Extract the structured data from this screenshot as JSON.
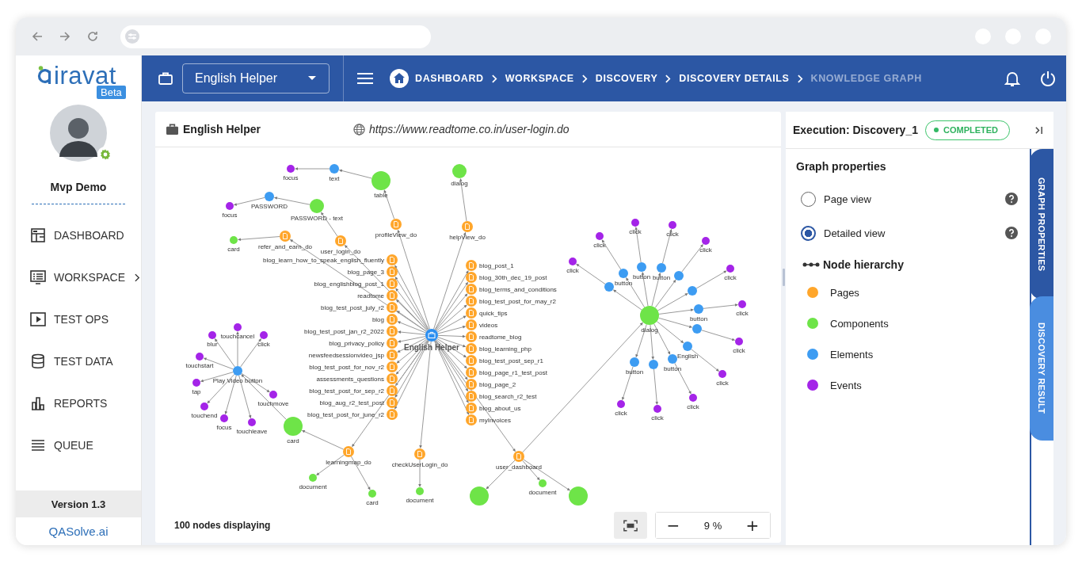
{
  "sidebar": {
    "logo": "iravat",
    "badge": "Beta",
    "user": "Mvp Demo",
    "menu": [
      {
        "label": "DASHBOARD",
        "has_submenu": false
      },
      {
        "label": "WORKSPACE",
        "has_submenu": true
      },
      {
        "label": "TEST OPS",
        "has_submenu": false
      },
      {
        "label": "TEST DATA",
        "has_submenu": false
      },
      {
        "label": "REPORTS",
        "has_submenu": false
      },
      {
        "label": "QUEUE",
        "has_submenu": false
      }
    ],
    "version": "Version 1.3",
    "brand": "QASolve.ai"
  },
  "header": {
    "project": "English Helper",
    "breadcrumbs": [
      {
        "label": "DASHBOARD",
        "current": false
      },
      {
        "label": "WORKSPACE",
        "current": false
      },
      {
        "label": "DISCOVERY",
        "current": false
      },
      {
        "label": "DISCOVERY DETAILS",
        "current": false
      },
      {
        "label": "KNOWLEDGE GRAPH",
        "current": true
      }
    ]
  },
  "graph_card": {
    "title": "English Helper",
    "url": "https://www.readtome.co.in/user-login.do",
    "graph": {
      "label": "English Helper",
      "kind": "root",
      "children": [
        {
          "label": "profileView_do",
          "kind": "page",
          "children": [
            {
              "label": "table",
              "kind": "component",
              "children": [
                {
                  "label": "text",
                  "kind": "element",
                  "children": [
                    {
                      "label": "focus",
                      "kind": "event"
                    }
                  ]
                }
              ]
            }
          ]
        },
        {
          "label": "helpView_do",
          "kind": "page",
          "children": [
            {
              "label": "dialog",
              "kind": "component"
            }
          ]
        },
        {
          "label": "refer_and_earn_do",
          "kind": "page",
          "children": [
            {
              "label": "card",
              "kind": "component"
            }
          ]
        },
        {
          "label": "user_login_do",
          "kind": "page",
          "children": [
            {
              "label": "PASSWORD - text",
              "kind": "component",
              "children": [
                {
                  "label": "PASSWORD",
                  "kind": "element",
                  "children": [
                    {
                      "label": "focus",
                      "kind": "event"
                    }
                  ]
                }
              ]
            }
          ]
        },
        {
          "label": "blog_learn_how_to_speak_english_fluently",
          "kind": "page"
        },
        {
          "label": "blog_post_1",
          "kind": "page"
        },
        {
          "label": "blog_page_3",
          "kind": "page"
        },
        {
          "label": "blog_30th_dec_19_post",
          "kind": "page"
        },
        {
          "label": "blog_englishblog_post_1",
          "kind": "page"
        },
        {
          "label": "blog_terms_and_conditions",
          "kind": "page"
        },
        {
          "label": "readtome",
          "kind": "page"
        },
        {
          "label": "blog_test_post_for_may_r2",
          "kind": "page"
        },
        {
          "label": "blog_test_post_july_r2",
          "kind": "page"
        },
        {
          "label": "quick_tips",
          "kind": "page"
        },
        {
          "label": "blog",
          "kind": "page"
        },
        {
          "label": "videos",
          "kind": "page"
        },
        {
          "label": "blog_test_post_jan_r2_2022",
          "kind": "page"
        },
        {
          "label": "readtome_blog",
          "kind": "page"
        },
        {
          "label": "blog_privacy_policy",
          "kind": "page"
        },
        {
          "label": "blog_learning_php",
          "kind": "page"
        },
        {
          "label": "newsfeedsessionvideo_jsp",
          "kind": "page"
        },
        {
          "label": "blog_test_post_sep_r1",
          "kind": "page"
        },
        {
          "label": "blog_test_post_for_nov_r2",
          "kind": "page"
        },
        {
          "label": "blog_page_r1_test_post",
          "kind": "page"
        },
        {
          "label": "assessments_questions",
          "kind": "page"
        },
        {
          "label": "blog_page_2",
          "kind": "page"
        },
        {
          "label": "blog_test_post_for_sep_r2",
          "kind": "page"
        },
        {
          "label": "blog_search_r2_test",
          "kind": "page"
        },
        {
          "label": "blog_aug_r2_test_post",
          "kind": "page"
        },
        {
          "label": "blog_about_us",
          "kind": "page"
        },
        {
          "label": "blog_test_post_for_june_r2",
          "kind": "page"
        },
        {
          "label": "myInvoices",
          "kind": "page"
        },
        {
          "label": "learningmap_do",
          "kind": "page",
          "children": [
            {
              "label": "card",
              "kind": "component",
              "children": [
                {
                  "label": "Play Video button",
                  "kind": "element",
                  "children": [
                    {
                      "label": "touchcancel",
                      "kind": "event"
                    },
                    {
                      "label": "blur",
                      "kind": "event"
                    },
                    {
                      "label": "click",
                      "kind": "event"
                    },
                    {
                      "label": "touchstart",
                      "kind": "event"
                    },
                    {
                      "label": "tap",
                      "kind": "event"
                    },
                    {
                      "label": "touchmove",
                      "kind": "event"
                    },
                    {
                      "label": "touchend",
                      "kind": "event"
                    },
                    {
                      "label": "focus",
                      "kind": "event"
                    },
                    {
                      "label": "touchleave",
                      "kind": "event"
                    }
                  ]
                }
              ]
            },
            {
              "label": "document",
              "kind": "component"
            },
            {
              "label": "card",
              "kind": "component"
            }
          ]
        },
        {
          "label": "checkUserLogin_do",
          "kind": "page",
          "children": [
            {
              "label": "document",
              "kind": "component"
            }
          ]
        },
        {
          "label": "user_dashboard",
          "kind": "page",
          "children": [
            {
              "label": "dialog",
              "kind": "component",
              "children": [
                {
                  "label": "button",
                  "kind": "element",
                  "children": [
                    {
                      "label": "click",
                      "kind": "event"
                    }
                  ]
                },
                {
                  "label": "button",
                  "kind": "element",
                  "children": [
                    {
                      "label": "click",
                      "kind": "event"
                    }
                  ]
                },
                {
                  "label": "button",
                  "kind": "element",
                  "children": [
                    {
                      "label": "click",
                      "kind": "event"
                    }
                  ]
                },
                {
                  "kind": "element",
                  "children": [
                    {
                      "label": "click",
                      "kind": "event"
                    }
                  ]
                },
                {
                  "kind": "element",
                  "children": [
                    {
                      "label": "click",
                      "kind": "event"
                    }
                  ]
                },
                {
                  "kind": "element",
                  "children": [
                    {
                      "label": "click",
                      "kind": "event"
                    }
                  ]
                },
                {
                  "label": "button",
                  "kind": "element",
                  "children": [
                    {
                      "label": "click",
                      "kind": "event"
                    }
                  ]
                },
                {
                  "kind": "element",
                  "children": [
                    {
                      "label": "click",
                      "kind": "event"
                    }
                  ]
                },
                {
                  "label": "English",
                  "kind": "element",
                  "children": [
                    {
                      "label": "click",
                      "kind": "event"
                    }
                  ]
                },
                {
                  "label": "button",
                  "kind": "element",
                  "children": [
                    {
                      "label": "click",
                      "kind": "event"
                    }
                  ]
                },
                {
                  "label": "button",
                  "kind": "element",
                  "children": [
                    {
                      "label": "click",
                      "kind": "event"
                    }
                  ]
                },
                {
                  "kind": "element",
                  "children": [
                    {
                      "label": "click",
                      "kind": "event"
                    }
                  ]
                }
              ]
            },
            {
              "label": "document",
              "kind": "component"
            },
            {
              "kind": "component"
            },
            {
              "kind": "component"
            }
          ]
        }
      ]
    },
    "node_count": "100 nodes displaying",
    "zoom_out": "−",
    "zoom": "9 %",
    "zoom_in": "+"
  },
  "panel": {
    "execution": "Execution: Discovery_1",
    "status": "COMPLETED",
    "section": "Graph properties",
    "views": [
      {
        "label": "Page view",
        "selected": false
      },
      {
        "label": "Detailed view",
        "selected": true
      }
    ],
    "legend_title": "Node hierarchy",
    "legend": [
      {
        "label": "Pages",
        "kind": "page",
        "color": "#ffa62b"
      },
      {
        "label": "Components",
        "kind": "component",
        "color": "#6ee448"
      },
      {
        "label": "Elements",
        "kind": "element",
        "color": "#3d9cf2"
      },
      {
        "label": "Events",
        "kind": "event",
        "color": "#a424e8"
      }
    ],
    "tabs": [
      {
        "label": "GRAPH PROPERTIES",
        "selected": true
      },
      {
        "label": "DISCOVERY RESULT",
        "selected": false
      }
    ]
  }
}
